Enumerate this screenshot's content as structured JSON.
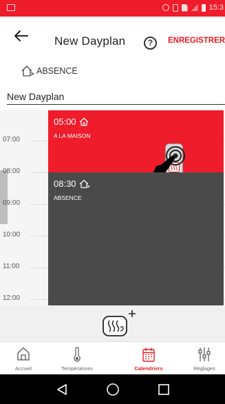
{
  "status_bar": {
    "time": "15:3"
  },
  "header": {
    "title": "New Dayplan",
    "save_label": "ENREGISTRER",
    "help_label": "?"
  },
  "mode": {
    "label": "ABSENCE",
    "icon": "house-away-icon"
  },
  "plan_name": {
    "value": "New Dayplan",
    "placeholder": "New Dayplan"
  },
  "timeline": {
    "hours": [
      "07:00",
      "08:00",
      "09:00",
      "10:00",
      "11:00",
      "12:00"
    ],
    "blocks": [
      {
        "time": "05:00",
        "name": "A LA MAISON",
        "color": "#ef1c2b",
        "icon": "house-home-icon"
      },
      {
        "time": "08:30",
        "name": "ABSENCE",
        "color": "#4a4a4a",
        "icon": "house-away-icon"
      }
    ]
  },
  "add_block": {
    "icon": "heater-add-icon"
  },
  "bottom_nav": {
    "items": [
      {
        "label": "Accueil",
        "icon": "home-icon"
      },
      {
        "label": "Températures",
        "icon": "thermometer-icon"
      },
      {
        "label": "Calendriers",
        "icon": "calendar-icon",
        "active": true
      },
      {
        "label": "Réglages",
        "icon": "sliders-icon"
      }
    ]
  },
  "colors": {
    "accent": "#e31b23",
    "away_block": "#4a4a4a"
  }
}
